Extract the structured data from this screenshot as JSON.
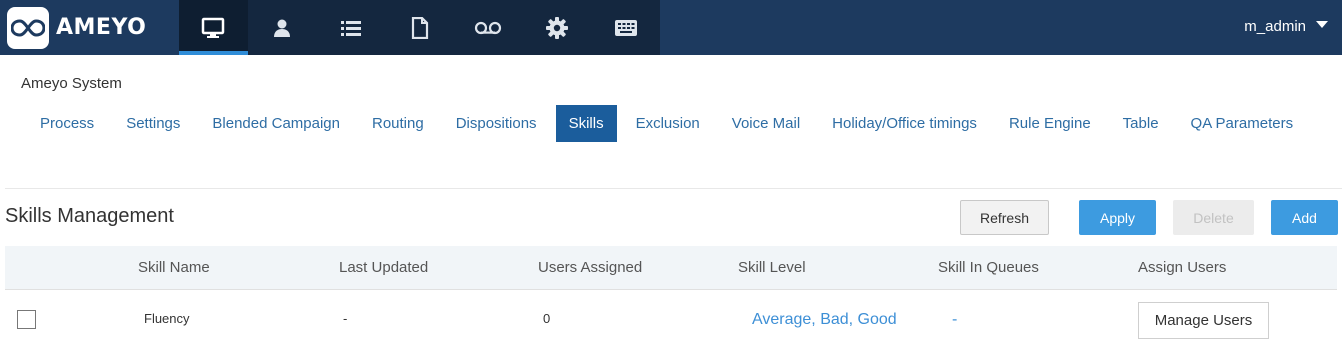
{
  "app": {
    "logo_text": "AMEYO"
  },
  "topnav": {
    "icons": [
      "monitor-icon",
      "user-icon",
      "list-icon",
      "document-icon",
      "voicemail-icon",
      "gear-icon",
      "keyboard-icon"
    ],
    "active_index": 0,
    "user": {
      "name": "m_admin"
    }
  },
  "breadcrumb": "Ameyo System",
  "tabs": [
    {
      "label": "Process"
    },
    {
      "label": "Settings"
    },
    {
      "label": "Blended Campaign"
    },
    {
      "label": "Routing"
    },
    {
      "label": "Dispositions"
    },
    {
      "label": "Skills",
      "active": true
    },
    {
      "label": "Exclusion"
    },
    {
      "label": "Voice Mail"
    },
    {
      "label": "Holiday/Office timings"
    },
    {
      "label": "Rule Engine"
    },
    {
      "label": "Table"
    },
    {
      "label": "QA Parameters"
    }
  ],
  "section": {
    "title": "Skills Management",
    "buttons": {
      "refresh": "Refresh",
      "apply": "Apply",
      "delete": "Delete",
      "add": "Add"
    }
  },
  "table": {
    "columns": [
      "Skill Name",
      "Last Updated",
      "Users Assigned",
      "Skill Level",
      "Skill In Queues",
      "Assign Users"
    ],
    "rows": [
      {
        "skill_name": "Fluency",
        "last_updated": "-",
        "users_assigned": "0",
        "skill_level": "Average, Bad, Good",
        "skill_in_queues": "-",
        "assign_users": "Manage Users"
      }
    ]
  },
  "colors": {
    "topbar": "#1d3a5f",
    "accent": "#3d9be0",
    "active_tab": "#1b5d9c",
    "link": "#3d8fd6"
  }
}
